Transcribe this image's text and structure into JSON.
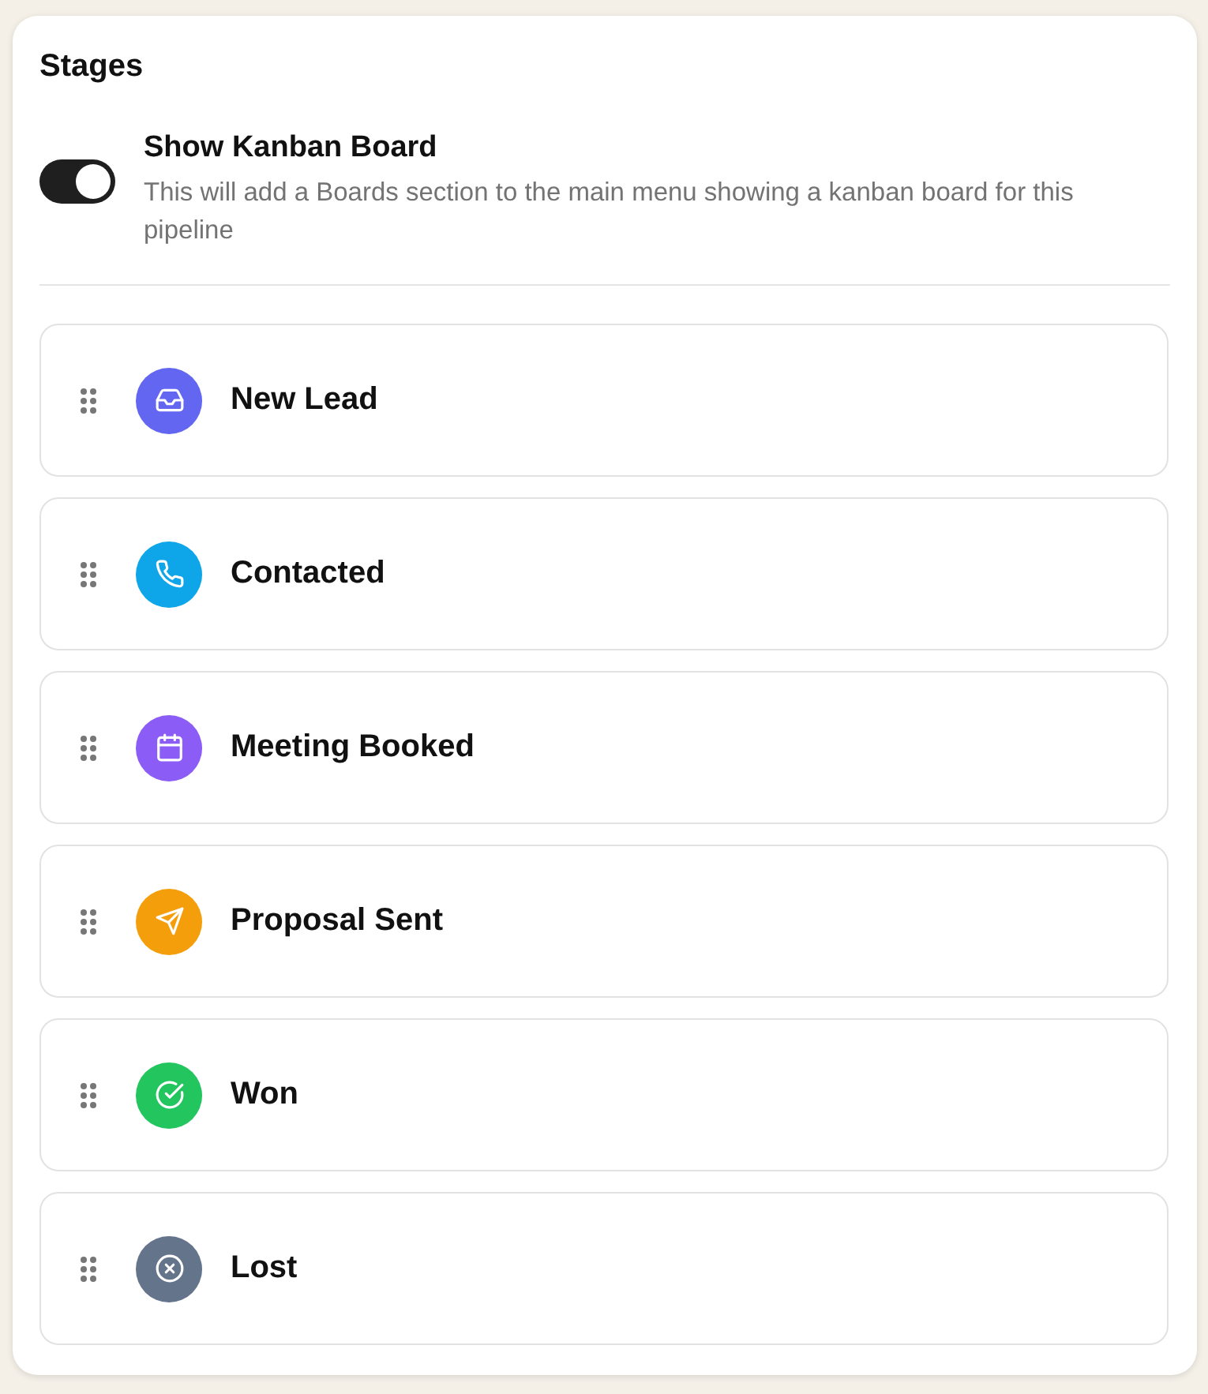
{
  "section": {
    "title": "Stages"
  },
  "kanban_toggle": {
    "label": "Show Kanban Board",
    "description": "This will add a Boards section to the main menu showing a kanban board for this pipeline",
    "on": true
  },
  "stages": [
    {
      "name": "New Lead",
      "kind": "inbox",
      "color": "#6366f1"
    },
    {
      "name": "Contacted",
      "kind": "phone",
      "color": "#0ea5e9"
    },
    {
      "name": "Meeting Booked",
      "kind": "calendar",
      "color": "#8b5cf6"
    },
    {
      "name": "Proposal Sent",
      "kind": "send",
      "color": "#f59e0b"
    },
    {
      "name": "Won",
      "kind": "check",
      "color": "#22c55e"
    },
    {
      "name": "Lost",
      "kind": "cancel",
      "color": "#64748b"
    }
  ]
}
